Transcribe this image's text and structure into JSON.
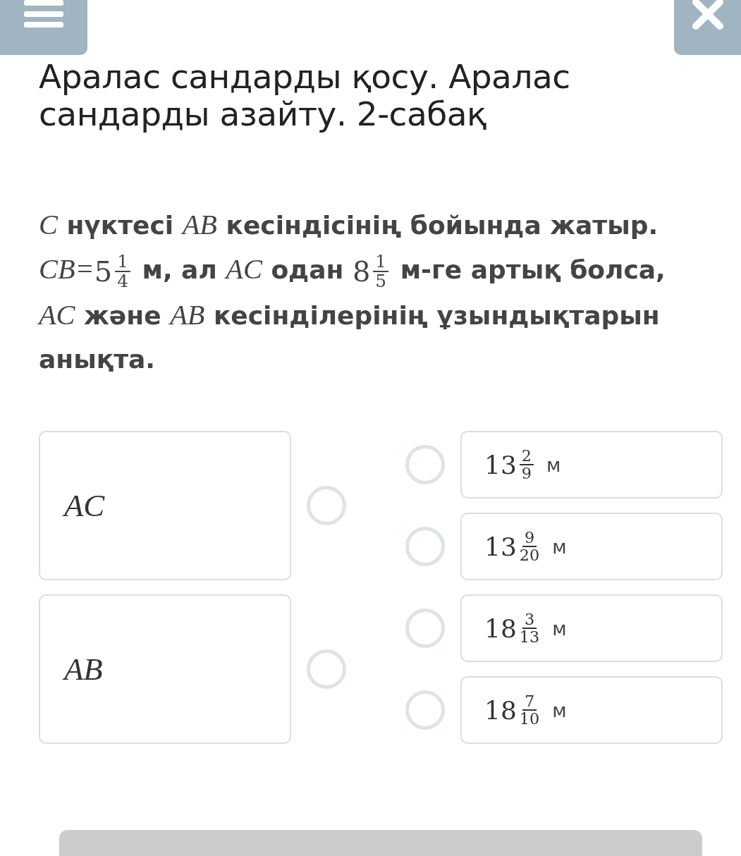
{
  "title": "Аралас сандарды қосу. Аралас сандарды азайту. 2-сабақ",
  "question": [
    {
      "kind": "math",
      "text": "C"
    },
    {
      "kind": "text",
      "text": " нүктесі "
    },
    {
      "kind": "math",
      "text": "AB"
    },
    {
      "kind": "text",
      "text": " кесіндісінің бойында жатыр. "
    },
    {
      "kind": "math",
      "text": "CB="
    },
    {
      "kind": "mixed",
      "whole": "5",
      "num": "1",
      "den": "4"
    },
    {
      "kind": "text",
      "text": " м, ал "
    },
    {
      "kind": "math",
      "text": "AC"
    },
    {
      "kind": "text",
      "text": " одан "
    },
    {
      "kind": "mixed",
      "whole": "8",
      "num": "1",
      "den": "5"
    },
    {
      "kind": "text",
      "text": " м-ге артық болса, "
    },
    {
      "kind": "math",
      "text": "AC"
    },
    {
      "kind": "text",
      "text": " және "
    },
    {
      "kind": "math",
      "text": "AB"
    },
    {
      "kind": "text",
      "text": " кесінділерінің ұзындықтарын анықта."
    }
  ],
  "pairs": [
    {
      "item": {
        "label": "AC",
        "selected": false
      },
      "options": [
        {
          "whole": "13",
          "num": "2",
          "den": "9",
          "unit": "м",
          "selected": false
        },
        {
          "whole": "13",
          "num": "9",
          "den": "20",
          "unit": "м",
          "selected": false
        }
      ]
    },
    {
      "item": {
        "label": "AB",
        "selected": false
      },
      "options": [
        {
          "whole": "18",
          "num": "3",
          "den": "13",
          "unit": "м",
          "selected": false
        },
        {
          "whole": "18",
          "num": "7",
          "den": "10",
          "unit": "м",
          "selected": false
        }
      ]
    }
  ]
}
